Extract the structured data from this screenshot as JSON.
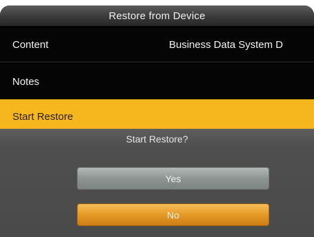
{
  "title": "Restore from Device",
  "rows": [
    {
      "label": "Content",
      "value": "Business Data System D"
    },
    {
      "label": "Notes"
    },
    {
      "label": "Start Restore"
    }
  ],
  "dialog": {
    "prompt": "Start Restore?",
    "yes_label": "Yes",
    "no_label": "No"
  },
  "colors": {
    "highlight": "#f6b71e",
    "background": "#000000",
    "dialog": "#4f4f4f",
    "yes_button": "#8d9592",
    "no_button": "#e59a26"
  }
}
